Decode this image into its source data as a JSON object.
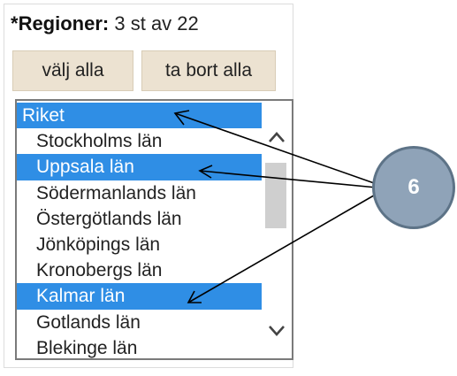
{
  "header": {
    "required_mark": "*",
    "label": "Regioner:",
    "count_text": "3 st av 22"
  },
  "buttons": {
    "select_all": "välj alla",
    "remove_all": "ta bort alla"
  },
  "regions": [
    {
      "label": "Riket",
      "selected": true
    },
    {
      "label": "Stockholms län",
      "selected": false
    },
    {
      "label": "Uppsala län",
      "selected": true
    },
    {
      "label": "Södermanlands län",
      "selected": false
    },
    {
      "label": "Östergötlands län",
      "selected": false
    },
    {
      "label": "Jönköpings län",
      "selected": false
    },
    {
      "label": "Kronobergs län",
      "selected": false
    },
    {
      "label": "Kalmar län",
      "selected": true
    },
    {
      "label": "Gotlands län",
      "selected": false
    },
    {
      "label": "Blekinge län",
      "selected": false
    }
  ],
  "callout": {
    "number": "6"
  },
  "colors": {
    "selection": "#2f8ee5",
    "button_bg": "#ece2d1",
    "callout_fill": "#8fa3b8",
    "callout_border": "#5d7387"
  },
  "icons": {
    "scroll_up": "chevron-up-icon",
    "scroll_down": "chevron-down-icon"
  }
}
